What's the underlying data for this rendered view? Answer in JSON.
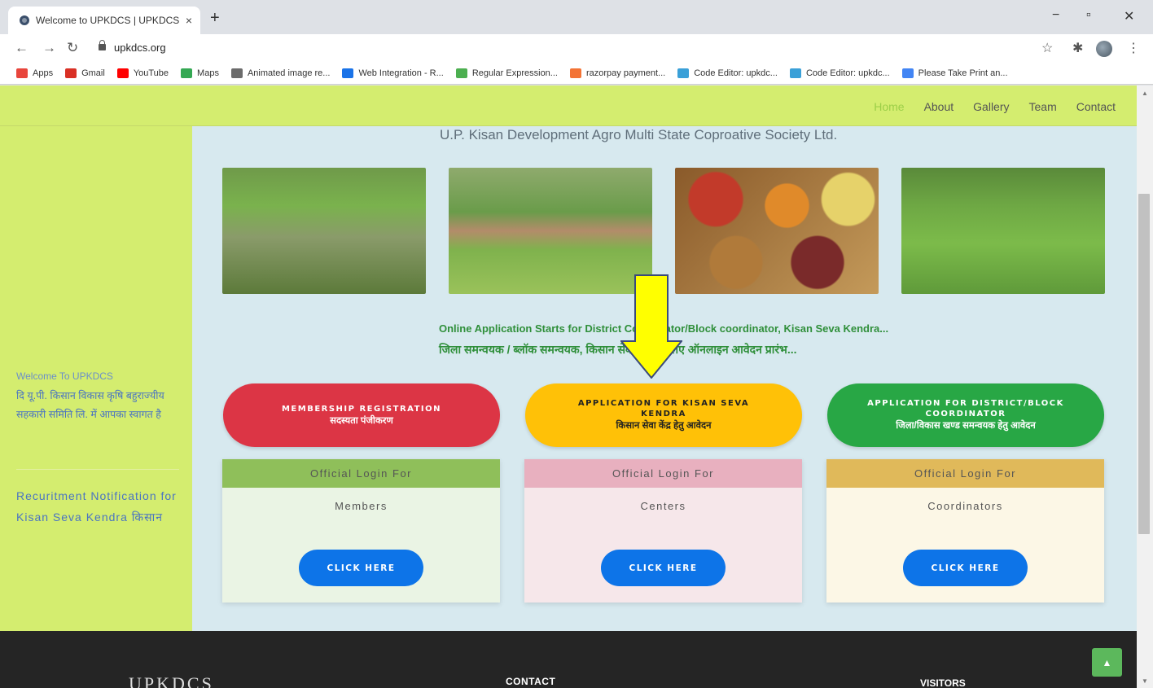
{
  "browser": {
    "tab_title": "Welcome to UPKDCS | UPKDCS",
    "tab_close": "×",
    "new_tab": "+",
    "url": "upkdcs.org",
    "window_controls": {
      "minimize": "−",
      "maximize": "▫",
      "close": "✕"
    },
    "nav": {
      "back": "←",
      "forward": "→",
      "reload": "↻"
    },
    "toolbar_icons": {
      "star": "☆",
      "extensions": "✱",
      "menu": "⋮"
    },
    "bookmarks": [
      {
        "label": "Apps",
        "icon": "apps-grid-icon",
        "color": "#e8453c"
      },
      {
        "label": "Gmail",
        "icon": "gmail-icon",
        "color": "#d93025"
      },
      {
        "label": "YouTube",
        "icon": "youtube-icon",
        "color": "#ff0000"
      },
      {
        "label": "Maps",
        "icon": "maps-icon",
        "color": "#34a853"
      },
      {
        "label": "Animated image re...",
        "icon": "image-icon",
        "color": "#6b6b6b"
      },
      {
        "label": "Web Integration - R...",
        "icon": "feather-icon",
        "color": "#1a73e8"
      },
      {
        "label": "Regular Expression...",
        "icon": "regex-icon",
        "color": "#4caf50"
      },
      {
        "label": "razorpay payment...",
        "icon": "razorpay-icon",
        "color": "#f37335"
      },
      {
        "label": "Code Editor: upkdc...",
        "icon": "code-editor-icon",
        "color": "#3aa0d8"
      },
      {
        "label": "Code Editor: upkdc...",
        "icon": "code-editor-icon",
        "color": "#3aa0d8"
      },
      {
        "label": "Please Take Print an...",
        "icon": "google-icon",
        "color": "#4285f4"
      }
    ]
  },
  "nav": {
    "items": [
      {
        "label": "Home",
        "active": true
      },
      {
        "label": "About",
        "active": false
      },
      {
        "label": "Gallery",
        "active": false
      },
      {
        "label": "Team",
        "active": false
      },
      {
        "label": "Contact",
        "active": false
      }
    ]
  },
  "sidebar": {
    "welcome_en": "Welcome To UPKDCS",
    "welcome_hi": "दि यू.पी. किसान विकास कृषि बहुराज्यीय सहकारी समिति लि. में आपका स्वागत है",
    "recruitment": "Recuritment Notification for Kisan Seva Kendra किसान"
  },
  "main": {
    "org_name": "U.P. Kisan Development Agro Multi State Coproative Society Ltd.",
    "notice_en": "Online Application Starts for District Coordinator/Block coordinator, Kisan Seva Kendra...",
    "notice_hi": "जिला समन्वयक / ब्लॉक समन्वयक, किसान सेवा केंद्र के लिए ऑनलाइन आवेदन प्रारंभ...",
    "application_buttons": [
      {
        "line1": "MEMBERSHIP REGISTRATION",
        "line2": "सदस्यता पंजीकरण"
      },
      {
        "line1": "APPLICATION FOR KISAN SEVA KENDRA",
        "line2": "किसान सेवा केंद्र हेतु आवेदन"
      },
      {
        "line1": "APPLICATION FOR DISTRICT/BLOCK COORDINATOR",
        "line2": "जिला/विकास खण्ड समन्वयक हेतु आवेदन"
      }
    ],
    "login_cards": [
      {
        "header": "Official Login For",
        "role": "Members",
        "button": "CLICK HERE"
      },
      {
        "header": "Official Login For",
        "role": "Centers",
        "button": "CLICK HERE"
      },
      {
        "header": "Official Login For",
        "role": "Coordinators",
        "button": "CLICK HERE"
      }
    ]
  },
  "footer": {
    "logo": "UPKDCS",
    "contact_heading": "CONTACT",
    "visitors_heading": "VISITORS",
    "to_top": "▲"
  },
  "colors": {
    "nav_bg": "#d4ed6f",
    "page_bg": "#d7e9ef",
    "red_button": "#dc3545",
    "yellow_button": "#ffc107",
    "green_button": "#28a745",
    "login_button": "#0d74e8",
    "footer_bg": "#252525",
    "notice_text": "#2f8f3a",
    "arrow_fill": "#ffff00"
  }
}
